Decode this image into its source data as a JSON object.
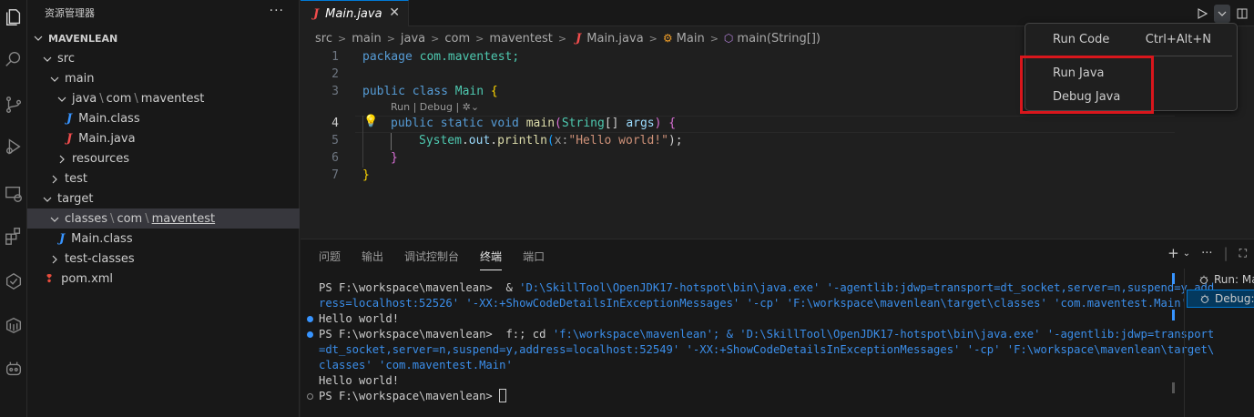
{
  "activity_bar": {
    "icons": [
      "explorer-icon",
      "search-icon",
      "source-control-icon",
      "run-debug-icon",
      "remote-explorer-icon",
      "extensions-icon",
      "testing-icon",
      "containers-icon",
      "copilot-icon"
    ]
  },
  "sidebar": {
    "title": "资源管理器",
    "more": "···",
    "project": "MAVENLEAN",
    "tree": [
      {
        "label": "src"
      },
      {
        "label": "main"
      },
      {
        "parts": [
          "java",
          "com",
          "maventest"
        ]
      },
      {
        "label": "Main.class"
      },
      {
        "label": "Main.java"
      },
      {
        "label": "resources"
      },
      {
        "label": "test"
      },
      {
        "label": "target"
      },
      {
        "parts": [
          "classes",
          "com",
          "maventest"
        ]
      },
      {
        "label": "Main.class"
      },
      {
        "label": "test-classes"
      },
      {
        "label": "pom.xml"
      }
    ]
  },
  "editor": {
    "tab": {
      "icon": "J",
      "label": "Main.java",
      "close": "✕"
    },
    "breadcrumb": [
      "src",
      "main",
      "java",
      "com",
      "maventest",
      "Main.java",
      "Main",
      "main(String[])"
    ],
    "line_numbers": [
      "1",
      "2",
      "3",
      "4",
      "5",
      "6",
      "7"
    ],
    "code": {
      "l1_kw": "package",
      "l1_rest": " com.maventest;",
      "l3_kw": "public class",
      "l3_name": " Main ",
      "l3_br": "{",
      "codelens": "Run | Debug | ",
      "l4_kw": "public static void",
      "l4_fn": " main",
      "l4_p1": "(",
      "l4_type": "String",
      "l4_arr": "[] ",
      "l4_arg": "args",
      "l4_p2": ") ",
      "l4_br": "{",
      "l5_obj": "System",
      "l5_dot1": ".",
      "l5_out": "out",
      "l5_dot2": ".",
      "l5_fn": "println",
      "l5_p1": "(",
      "l5_hint": "x:",
      "l5_str": "\"Hello world!\"",
      "l5_end": ");",
      "l6": "}",
      "l7": "}"
    }
  },
  "run_menu": {
    "items": [
      {
        "label": "Run Code",
        "shortcut": "Ctrl+Alt+N"
      },
      {
        "label": "Run Java"
      },
      {
        "label": "Debug Java"
      }
    ]
  },
  "panel": {
    "tabs": [
      "问题",
      "输出",
      "调试控制台",
      "终端",
      "端口"
    ],
    "active_tab": "终端",
    "terminal": {
      "l1a": "PS F:\\workspace\\mavenlean>  & ",
      "l1b": "'D:\\SkillTool\\OpenJDK17-hotspot\\bin\\java.exe' '-agentlib:jdwp=transport=dt_socket,server=n,suspend=y,add",
      "l2": "ress=localhost:52526' '-XX:+ShowCodeDetailsInExceptionMessages' '-cp' 'F:\\workspace\\mavenlean\\target\\classes' 'com.maventest.Main'",
      "l3": "Hello world!",
      "l4a": "PS F:\\workspace\\mavenlean>  f:; cd ",
      "l4b": "'f:\\workspace\\mavenlean'; & 'D:\\SkillTool\\OpenJDK17-hotspot\\bin\\java.exe' '-agentlib:jdwp=transport",
      "l5": "=dt_socket,server=n,suspend=y,address=localhost:52549' '-XX:+ShowCodeDetailsInExceptionMessages' '-cp' 'F:\\workspace\\mavenlean\\target\\",
      "l6": "classes' 'com.maventest.Main'",
      "l7": "Hello world!",
      "l8": "PS F:\\workspace\\mavenlean> "
    },
    "terminal_list": [
      "Run: Ma",
      "Debug:"
    ]
  }
}
